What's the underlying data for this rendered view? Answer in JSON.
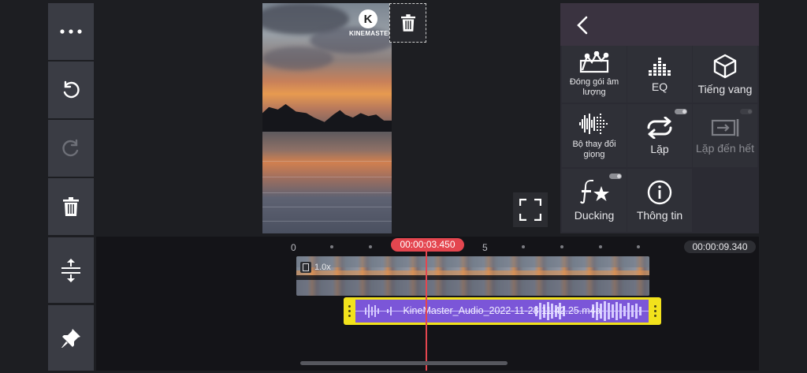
{
  "app": {
    "brand": "KINEMASTER"
  },
  "left_toolbar": {
    "items": [
      {
        "name": "more-options",
        "icon": "more-horizontal-icon"
      },
      {
        "name": "undo",
        "icon": "undo-icon"
      },
      {
        "name": "redo",
        "icon": "redo-icon",
        "disabled": true
      },
      {
        "name": "delete",
        "icon": "trash-icon"
      },
      {
        "name": "track-height",
        "icon": "expand-vertical-icon"
      },
      {
        "name": "pin",
        "icon": "pin-icon"
      }
    ]
  },
  "panel": {
    "back_icon": "chevron-left-icon",
    "cells": [
      {
        "id": "volume-envelope",
        "label": "Đóng gói âm lượng",
        "icon": "volume-envelope-icon"
      },
      {
        "id": "eq",
        "label": "EQ",
        "icon": "equalizer-icon"
      },
      {
        "id": "reverb",
        "label": "Tiếng vang",
        "icon": "cube-icon"
      },
      {
        "id": "voice-changer",
        "label": "Bộ thay đổi giọng",
        "icon": "voice-waveform-icon"
      },
      {
        "id": "loop",
        "label": "Lặp",
        "icon": "loop-icon",
        "toggle": "off"
      },
      {
        "id": "extend-to-end",
        "label": "Lặp đến hết",
        "icon": "extend-to-end-icon",
        "toggle": "off",
        "disabled": true
      },
      {
        "id": "ducking",
        "label": "Ducking",
        "icon": "ducking-icon",
        "toggle": "off"
      },
      {
        "id": "info",
        "label": "Thông tin",
        "icon": "info-icon"
      }
    ]
  },
  "timeline": {
    "current_time": "00:00:03.450",
    "total_time": "00:00:09.340",
    "ruler_labels": [
      "0",
      "5"
    ],
    "video_clip": {
      "speed": "1.0x"
    },
    "audio_clip": {
      "name": "KineMaster_Audio_2022-11-28 11.42.25.m4a"
    }
  },
  "colors": {
    "accent": "#e4464f",
    "audio_clip_border": "#f2e21c",
    "audio_clip_fill": "#7b56d8"
  }
}
